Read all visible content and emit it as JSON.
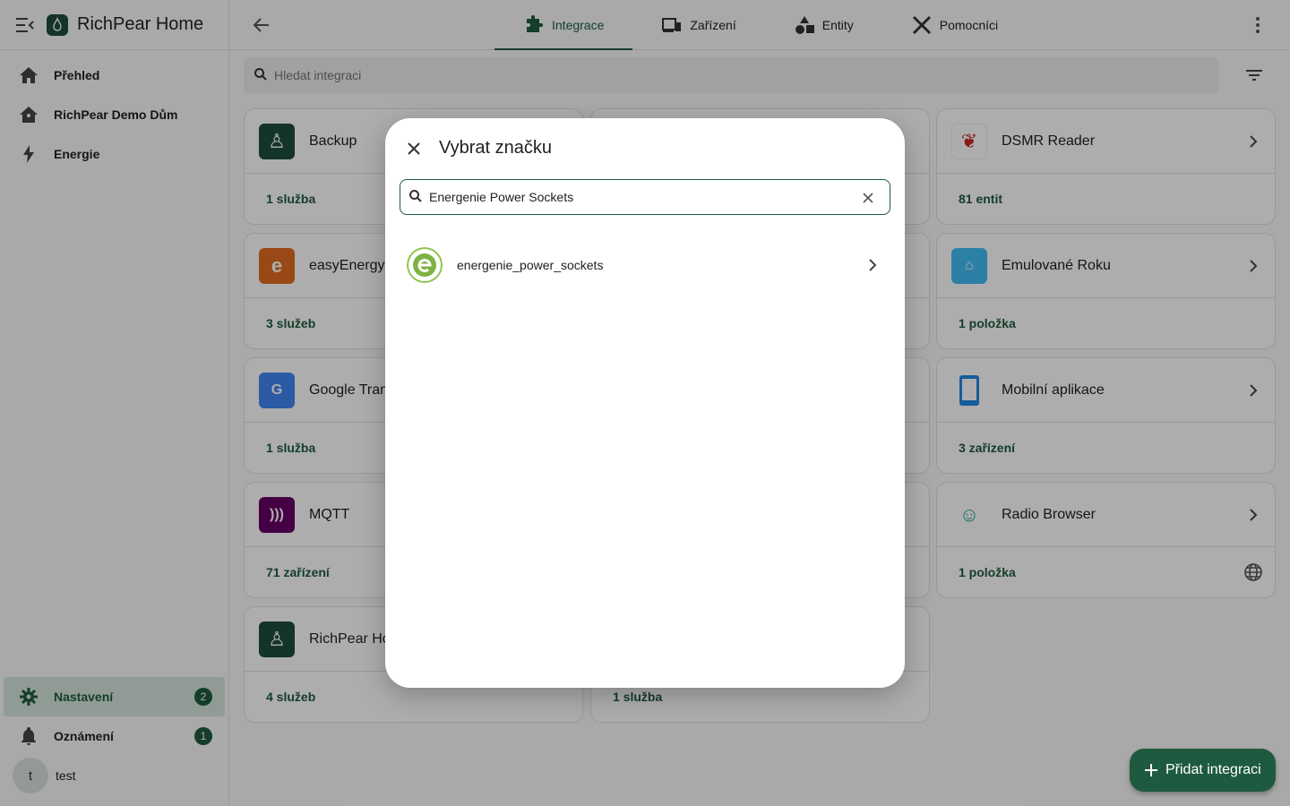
{
  "app": {
    "title": "RichPear Home"
  },
  "sidebar": {
    "items": [
      {
        "label": "Přehled",
        "icon": "home-icon"
      },
      {
        "label": "RichPear Demo Dům",
        "icon": "home-account-icon"
      },
      {
        "label": "Energie",
        "icon": "lightning-icon"
      }
    ],
    "bottom": {
      "settings": {
        "label": "Nastavení",
        "badge": "2"
      },
      "notifications": {
        "label": "Oznámení",
        "badge": "1"
      },
      "user": {
        "initial": "t",
        "name": "test"
      }
    }
  },
  "tabs": [
    {
      "label": "Integrace",
      "icon": "puzzle-icon",
      "active": true
    },
    {
      "label": "Zařízení",
      "icon": "devices-icon",
      "active": false
    },
    {
      "label": "Entity",
      "icon": "shapes-icon",
      "active": false
    },
    {
      "label": "Pomocníci",
      "icon": "tools-icon",
      "active": false
    }
  ],
  "search": {
    "placeholder": "Hledat integraci"
  },
  "cards": [
    {
      "name": "Backup",
      "footer": "1 služba"
    },
    {
      "name": "DSMR Reader",
      "footer": "81 entit"
    },
    {
      "name": "easyEnergy",
      "footer": "3 služeb"
    },
    {
      "name": "Emulované Roku",
      "footer": "1 položka"
    },
    {
      "name": "Google Tran",
      "footer": "1 služba"
    },
    {
      "name": "Mobilní aplikace",
      "footer": "3 zařízení"
    },
    {
      "name": "MQTT",
      "footer": "71 zařízení"
    },
    {
      "name": "Radio Browser",
      "footer": "1 položka"
    },
    {
      "name": "RichPear Ho",
      "footer": "4 služeb"
    },
    {
      "name": "",
      "footer": "1 služba"
    }
  ],
  "dialog": {
    "title": "Vybrat značku",
    "search_value": "Energenie Power Sockets",
    "results": [
      {
        "name": "energenie_power_sockets"
      }
    ]
  },
  "fab": {
    "label": "Přidat integraci"
  },
  "colors": {
    "primary": "#1e5a3f",
    "active_bg": "#d4e5dc"
  }
}
